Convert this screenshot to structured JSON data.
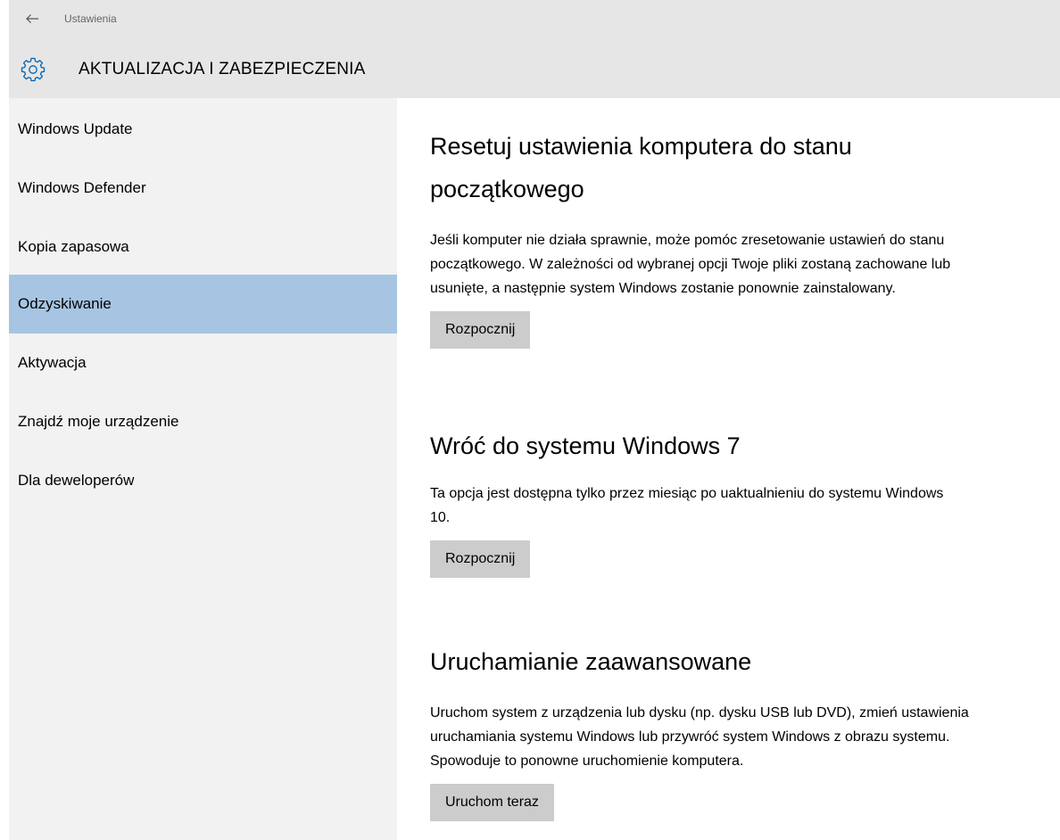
{
  "header": {
    "back_label": "Ustawienia",
    "section_title": "AKTUALIZACJA I ZABEZPIECZENIA",
    "icons": {
      "back": "arrow-left-icon",
      "section": "gear-icon"
    }
  },
  "sidebar": {
    "items": [
      {
        "label": "Windows Update",
        "selected": false
      },
      {
        "label": "Windows Defender",
        "selected": false
      },
      {
        "label": "Kopia zapasowa",
        "selected": false
      },
      {
        "label": "Odzyskiwanie",
        "selected": true
      },
      {
        "label": "Aktywacja",
        "selected": false
      },
      {
        "label": "Znajdź moje urządzenie",
        "selected": false
      },
      {
        "label": "Dla deweloperów",
        "selected": false
      }
    ]
  },
  "content": {
    "sections": [
      {
        "title": "Resetuj ustawienia komputera do stanu początkowego",
        "description": "Jeśli komputer nie działa sprawnie, może pomóc zresetowanie ustawień do stanu początkowego. W zależności od wybranej opcji Twoje pliki zostaną zachowane lub usunięte, a następnie system Windows zostanie ponownie zainstalowany.",
        "button": "Rozpocznij"
      },
      {
        "title": "Wróć do systemu Windows 7",
        "description": "Ta opcja jest dostępna tylko przez miesiąc po uaktualnieniu do systemu Windows 10.",
        "button": "Rozpocznij"
      },
      {
        "title": "Uruchamianie zaawansowane",
        "description": "Uruchom system z urządzenia lub dysku (np. dysku USB lub DVD), zmień ustawienia uruchamiania systemu Windows lub przywróć system Windows z obrazu systemu. Spowoduje to ponowne uruchomienie komputera.",
        "button": "Uruchom teraz"
      }
    ]
  },
  "colors": {
    "header_bg": "#e6e6e6",
    "sidebar_bg": "#f2f2f2",
    "selected_bg": "#a7c5e3",
    "button_bg": "#cccccc",
    "accent": "#0063b1"
  }
}
